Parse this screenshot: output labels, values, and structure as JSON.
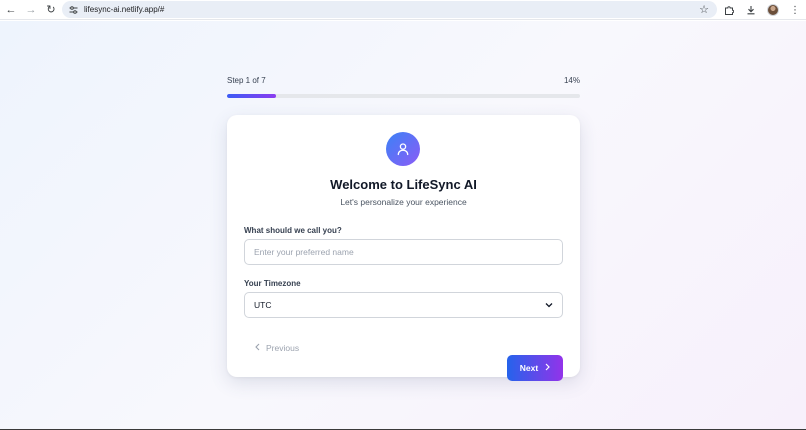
{
  "browser": {
    "url": "lifesync-ai.netlify.app/#",
    "icons": [
      "back-arrow-icon",
      "forward-arrow-icon",
      "reload-icon",
      "site-settings-icon",
      "bookmark-star-icon",
      "extensions-icon",
      "download-icon",
      "profile-avatar",
      "menu-kebab-icon"
    ]
  },
  "progress": {
    "step_text": "Step 1 of 7",
    "percent_text": "14%",
    "percent": 14
  },
  "card": {
    "icon": "user-icon",
    "title": "Welcome to LifeSync AI",
    "subtitle": "Let's personalize your experience",
    "name_field": {
      "label": "What should we call you?",
      "value": "",
      "placeholder": "Enter your preferred name"
    },
    "timezone_field": {
      "label": "Your Timezone",
      "selected": "UTC"
    },
    "previous_label": "Previous",
    "next_label": "Next"
  },
  "colors": {
    "accent_start": "#2563eb",
    "accent_end": "#9333ea"
  }
}
